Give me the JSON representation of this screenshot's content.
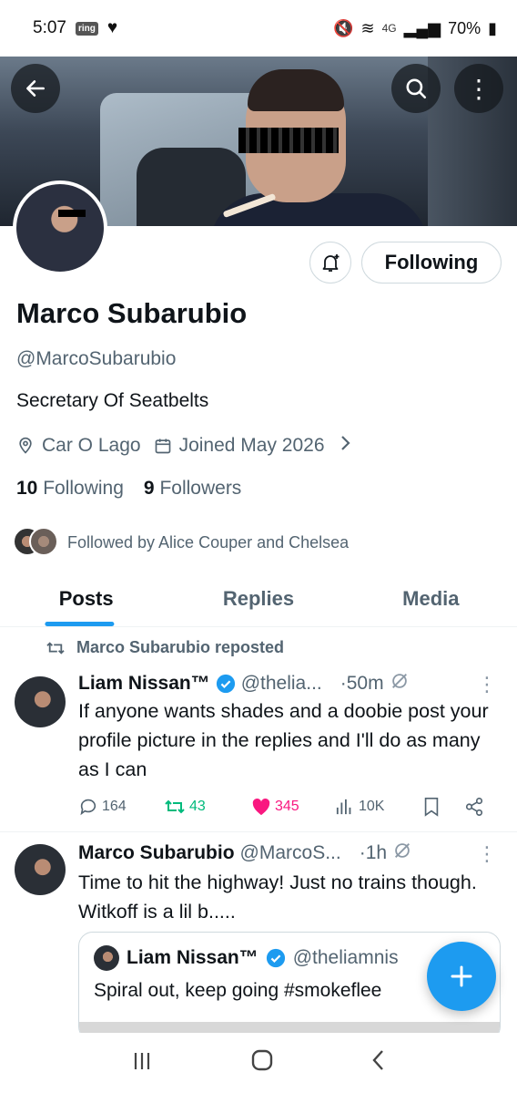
{
  "status_bar": {
    "time": "5:07",
    "ring_badge": "ring",
    "battery": "70%",
    "network": "4G"
  },
  "profile": {
    "display_name": "Marco Subarubio",
    "handle": "@MarcoSubarubio",
    "bio": "Secretary Of Seatbelts",
    "location": "Car O Lago",
    "joined": "Joined May 2026",
    "following_count": "10",
    "following_label": "Following",
    "followers_count": "9",
    "followers_label": "Followers",
    "followed_by": "Followed by Alice Couper and Chelsea",
    "follow_button": "Following"
  },
  "tabs": [
    {
      "label": "Posts",
      "active": true
    },
    {
      "label": "Replies"
    },
    {
      "label": "Media"
    }
  ],
  "posts": [
    {
      "repost_label": "Marco Subarubio reposted",
      "name": "Liam Nissan™",
      "handle": "@thelia...",
      "time": "·50m",
      "text": "If anyone wants shades and a doobie post your profile picture in the replies and I'll do as many as I can",
      "replies": "164",
      "reposts": "43",
      "likes": "345",
      "views": "10K"
    },
    {
      "name": "Marco Subarubio",
      "handle": "@MarcoS...",
      "time": "·1h",
      "text": "Time to hit the highway! Just no trains though. Witkoff is a lil b.....",
      "quote": {
        "name": "Liam Nissan™",
        "handle": "@theliamnis",
        "text": "Spiral out, keep going #smokeflee"
      }
    }
  ],
  "colors": {
    "accent": "#1d9bf0",
    "repost_green": "#00ba7c",
    "like_pink": "#f91880",
    "muted": "#536471"
  }
}
